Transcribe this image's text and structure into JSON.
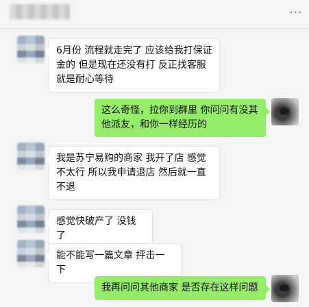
{
  "header": {
    "more_glyph": "···"
  },
  "messages": [
    {
      "side": "left",
      "text": "6月份 流程就走完了 应该给我打保证金的 但是现在还没有打 反正找客服就是耐心等待"
    },
    {
      "side": "right",
      "text": "这么奇怪，拉你到群里 你问问有没其他派友，和你一样经历的"
    },
    {
      "side": "left",
      "text": "我是苏宁易购的商家 我开了店 感觉不太行 所以我申请退店 然后就一直不退"
    },
    {
      "side": "left",
      "text": "感觉快破产了 没钱了"
    },
    {
      "side": "left",
      "text": "能不能写一篇文章 抨击一下"
    },
    {
      "side": "right",
      "text": "我再问问其他商家 是否存在这样问题"
    }
  ],
  "colors": {
    "background": "#f5f5f5",
    "incoming_bubble": "#ffffff",
    "outgoing_bubble": "#95ec69"
  },
  "icons": {
    "more": "more-icon",
    "avatar_other": "avatar",
    "avatar_self": "avatar"
  }
}
